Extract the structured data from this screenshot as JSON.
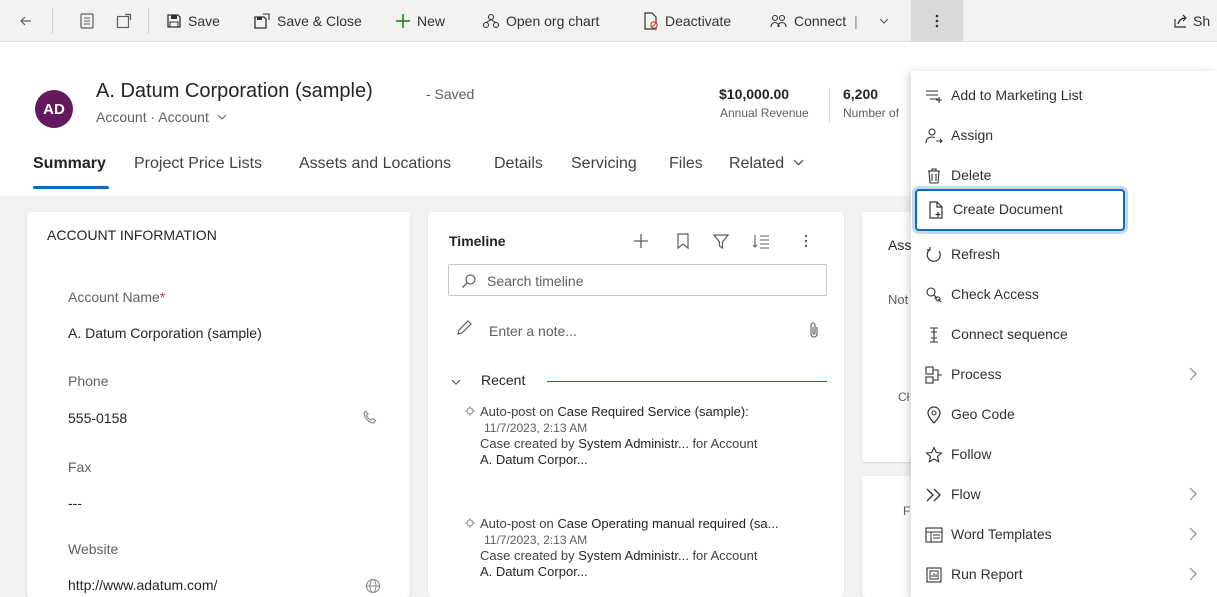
{
  "command_bar": {
    "back_icon": "arrow-left-icon",
    "save_label": "Save",
    "save_close_label": "Save & Close",
    "new_label": "New",
    "org_chart_label": "Open org chart",
    "deactivate_label": "Deactivate",
    "connect_label": "Connect",
    "share_label": "Sh"
  },
  "header": {
    "avatar_initials": "AD",
    "title": "A. Datum Corporation (sample)",
    "saved_status": "- Saved",
    "subtitle": "Account · Account",
    "metrics": [
      {
        "value": "$10,000.00",
        "label": "Annual Revenue"
      },
      {
        "value": "6,200",
        "label": "Number of"
      }
    ]
  },
  "tabs": [
    "Summary",
    "Project Price Lists",
    "Assets and Locations",
    "Details",
    "Servicing",
    "Files",
    "Related"
  ],
  "account_info": {
    "section_title": "ACCOUNT INFORMATION",
    "fields": [
      {
        "label": "Account Name",
        "required_mark": "*",
        "value": "A. Datum Corporation (sample)"
      },
      {
        "label": "Phone",
        "value": "555-0158"
      },
      {
        "label": "Fax",
        "value": "---"
      },
      {
        "label": "Website",
        "value": "http://www.adatum.com/"
      }
    ]
  },
  "timeline": {
    "title": "Timeline",
    "search_placeholder": "Search timeline",
    "note_placeholder": "Enter a note...",
    "recent_label": "Recent",
    "posts": [
      {
        "prefix": "Auto-post on ",
        "subject": "Case Required Service (sample):",
        "date": "11/7/2023, 2:13 AM",
        "body_prefix": "Case created by ",
        "body_user": "System Administr...",
        "body_suffix": " for Account",
        "account": "A. Datum Corpor..."
      },
      {
        "prefix": "Auto-post on ",
        "subject": "Case Operating manual required (sa...",
        "date": "11/7/2023, 2:13 AM",
        "body_prefix": "Case created by ",
        "body_user": "System Administr...",
        "body_suffix": " for Account",
        "account": "A. Datum Corpor..."
      }
    ]
  },
  "side_card": {
    "title_fragment": "Ass",
    "note_fragment": "Not",
    "ch_fragment": "Cł",
    "f_fragment": "F"
  },
  "overflow_menu": {
    "items": [
      {
        "label": "Add to Marketing List",
        "icon": "list-add-icon",
        "has_submenu": false
      },
      {
        "label": "Assign",
        "icon": "person-arrow-icon",
        "has_submenu": false
      },
      {
        "label": "Delete",
        "icon": "trash-icon",
        "has_submenu": false
      },
      {
        "label": "Create Document",
        "icon": "document-add-icon",
        "has_submenu": false,
        "highlighted": true
      },
      {
        "label": "Refresh",
        "icon": "refresh-icon",
        "has_submenu": false
      },
      {
        "label": "Check Access",
        "icon": "key-search-icon",
        "has_submenu": false
      },
      {
        "label": "Connect sequence",
        "icon": "sequence-icon",
        "has_submenu": false
      },
      {
        "label": "Process",
        "icon": "process-icon",
        "has_submenu": true
      },
      {
        "label": "Geo Code",
        "icon": "location-pin-icon",
        "has_submenu": false
      },
      {
        "label": "Follow",
        "icon": "star-icon",
        "has_submenu": false
      },
      {
        "label": "Flow",
        "icon": "flow-icon",
        "has_submenu": true
      },
      {
        "label": "Word Templates",
        "icon": "word-template-icon",
        "has_submenu": true
      },
      {
        "label": "Run Report",
        "icon": "report-icon",
        "has_submenu": true
      }
    ]
  },
  "colors": {
    "accent": "#0f6cbd",
    "avatar_bg": "#63195e",
    "required": "#c4314b"
  }
}
